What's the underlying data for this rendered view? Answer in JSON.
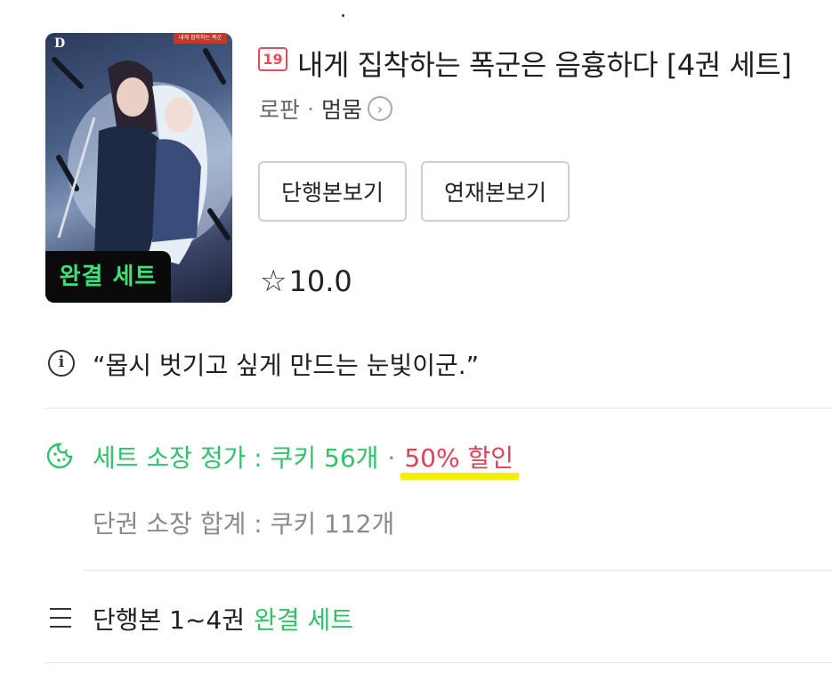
{
  "cover": {
    "logo": "D",
    "tag": "내게 집착하는 폭군",
    "art_title": "내게 집착하는 폭군은 음흉하다",
    "badge": "완결 세트"
  },
  "book": {
    "age_rating": "19",
    "title": "내게 집착하는 폭군은 음흉하다 [4권 세트]",
    "genre": "로판",
    "separator": "·",
    "author": "멈뭄",
    "rating": "10.0"
  },
  "buttons": {
    "single_volume": "단행본보기",
    "serial": "연재본보기"
  },
  "intro": {
    "quote": "“몹시 벗기고 싶게 만드는 눈빛이군.”"
  },
  "pricing": {
    "set_price_label": "세트 소장 정가 : 쿠키 56개",
    "separator": "·",
    "discount": "50% 할인",
    "single_total": "단권 소장 합계 : 쿠키 112개"
  },
  "volumes": {
    "label": "단행본 1~4권",
    "status": "완결 세트"
  },
  "icons": {
    "star": "star-outline-icon",
    "chevron": "chevron-right-circle-icon",
    "info": "info-circle-icon",
    "cookie": "cookie-icon",
    "list": "hamburger-list-icon"
  },
  "colors": {
    "accent_green": "#2fc36a",
    "badge_green": "#3ee07a",
    "discount_red": "#e0405a",
    "highlight_yellow": "#f4f000",
    "age_red": "#e64a5b"
  }
}
